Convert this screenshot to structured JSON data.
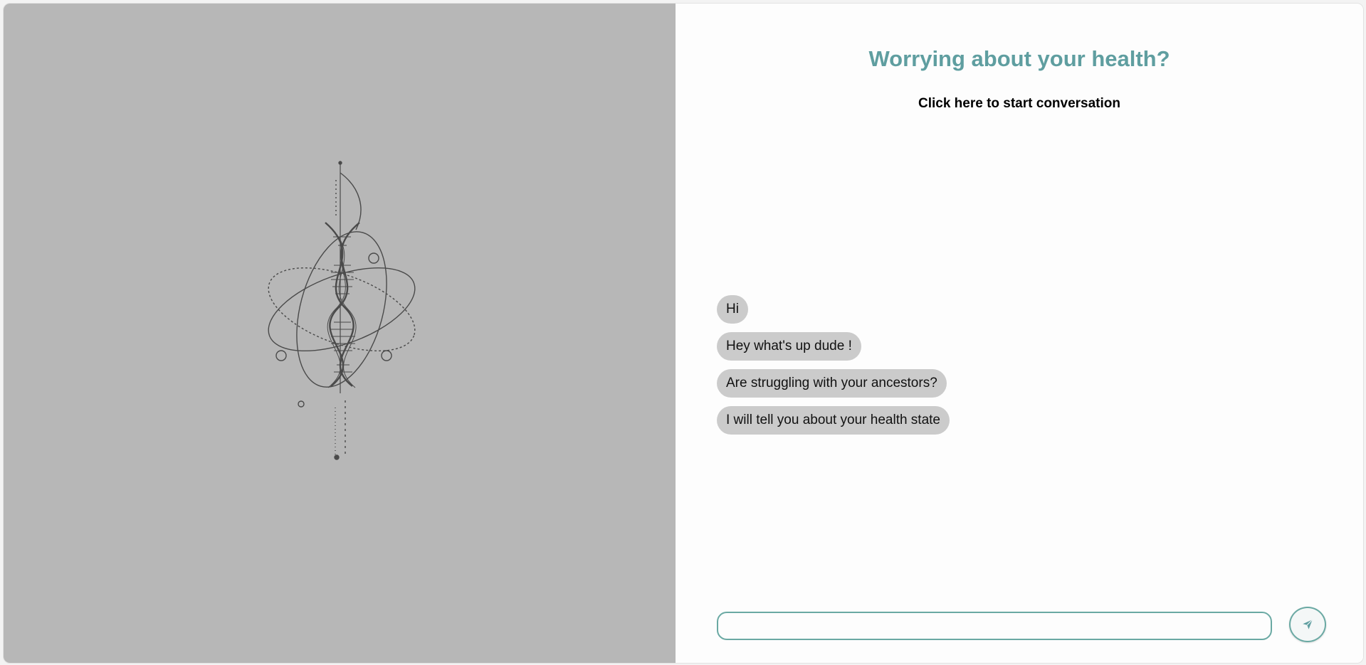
{
  "hero": {
    "headline": "Worrying about your health?",
    "start_link": "Click here to start conversation"
  },
  "chat": {
    "messages": [
      {
        "text": "Hi"
      },
      {
        "text": "Hey what's up dude !"
      },
      {
        "text": "Are struggling with your ancestors?"
      },
      {
        "text": "I will tell you about your health state"
      }
    ],
    "input_value": "",
    "input_placeholder": "",
    "send_icon": "send-icon"
  },
  "colors": {
    "accent": "#5f9ea0",
    "input_border": "#6aa9a3",
    "left_panel_bg": "#b7b7b7",
    "bubble_bg": "#cbcbcb"
  }
}
